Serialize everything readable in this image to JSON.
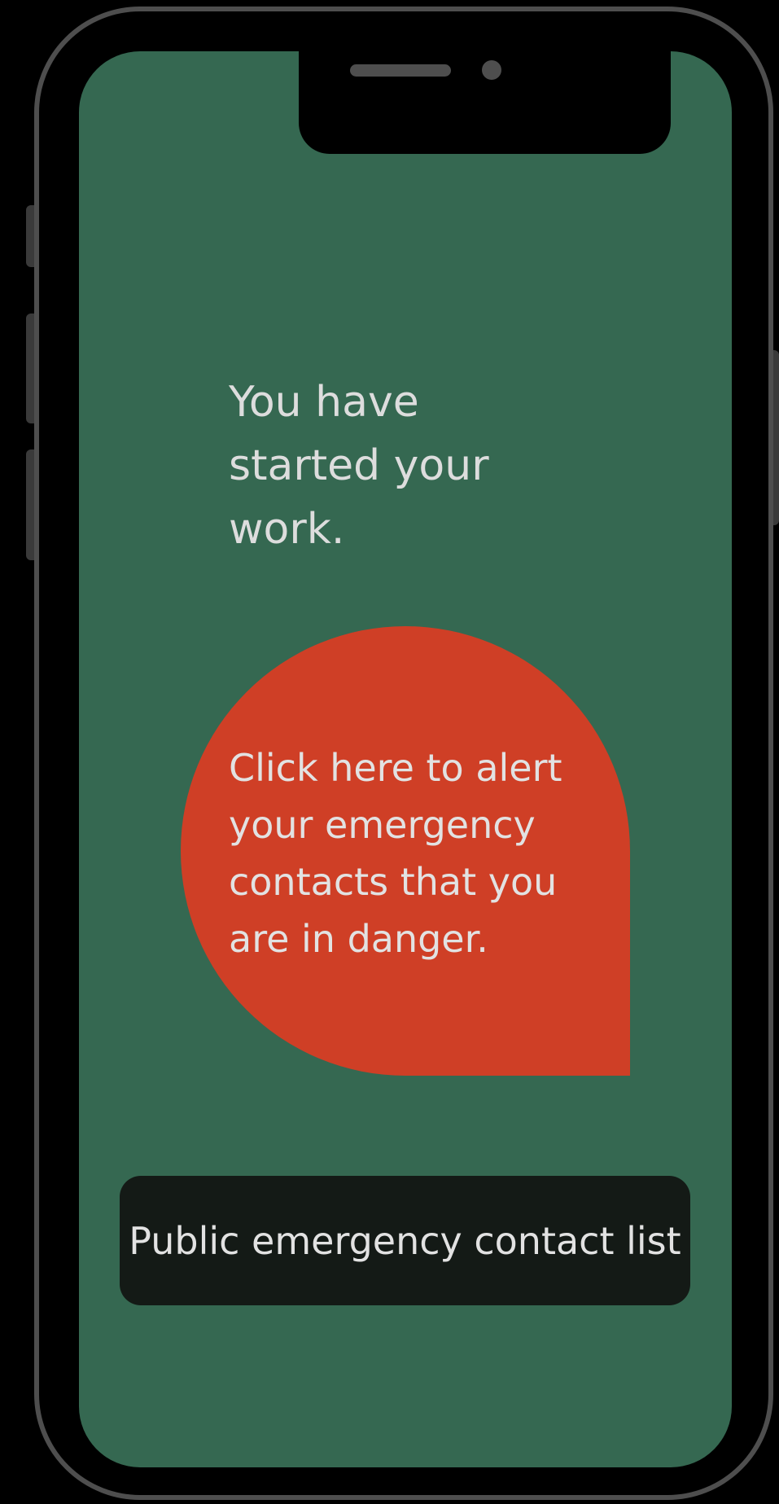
{
  "screen": {
    "background_color": "#356851",
    "status_message": "You have started your work.",
    "alert_button": {
      "label": "Click here to alert your emergency contacts that you are in danger.",
      "color": "#cf3f26"
    },
    "contact_list_button": {
      "label": "Public emergency contact list",
      "color": "#141a16"
    }
  }
}
